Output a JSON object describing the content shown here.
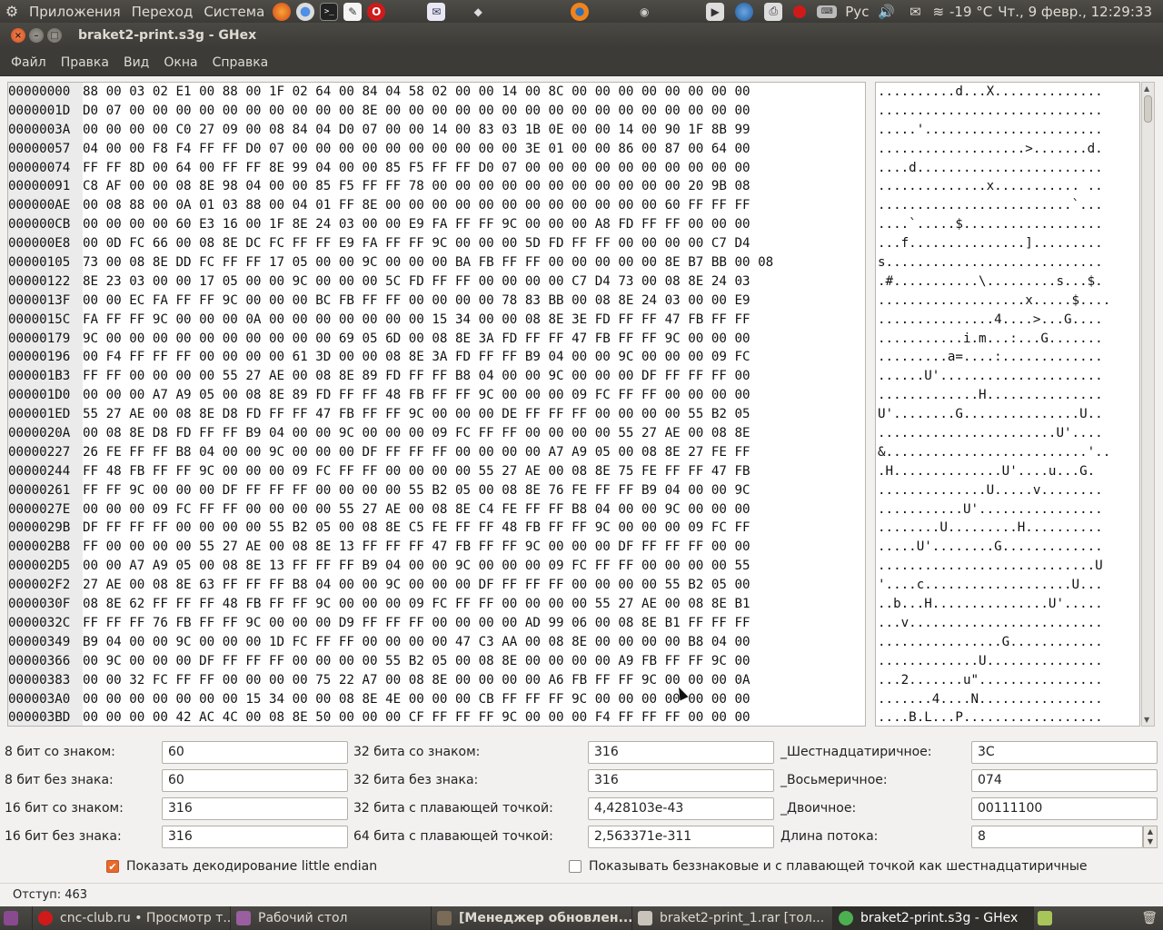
{
  "top_panel": {
    "menus": [
      "Приложения",
      "Переход",
      "Система"
    ],
    "keyboard_layout": "Рус",
    "weather": "-19 °C",
    "clock": "Чт., 9 февр., 12:29:33"
  },
  "window": {
    "title": "braket2-print.s3g - GHex"
  },
  "menu_bar": [
    "Файл",
    "Правка",
    "Вид",
    "Окна",
    "Справка"
  ],
  "hex_rows": [
    {
      "offset": "00000000",
      "hex": "88 00 03 02 E1 00 88 00 1F 02 64 00 84 04 58 02 00 00 14 00 8C 00 00 00 00 00 00 00 00",
      "ascii": "..........d...X.............."
    },
    {
      "offset": "0000001D",
      "hex": "D0 07 00 00 00 00 00 00 00 00 00 00 8E 00 00 00 00 00 00 00 00 00 00 00 00 00 00 00 00",
      "ascii": "............................."
    },
    {
      "offset": "0000003A",
      "hex": "00 00 00 00 C0 27 09 00 08 84 04 D0 07 00 00 14 00 83 03 1B 0E 00 00 14 00 90 1F 8B 99",
      "ascii": ".....'......................."
    },
    {
      "offset": "00000057",
      "hex": "04 00 00 F8 F4 FF FF D0 07 00 00 00 00 00 00 00 00 00 00 3E 01 00 00 86 00 87 00 64 00",
      "ascii": "...................>.......d."
    },
    {
      "offset": "00000074",
      "hex": "FF FF 8D 00 64 00 FF FF 8E 99 04 00 00 85 F5 FF FF D0 07 00 00 00 00 00 00 00 00 00 00",
      "ascii": "....d........................"
    },
    {
      "offset": "00000091",
      "hex": "C8 AF 00 00 08 8E 98 04 00 00 85 F5 FF FF 78 00 00 00 00 00 00 00 00 00 00 00 20 9B 08",
      "ascii": "..............x........... .."
    },
    {
      "offset": "000000AE",
      "hex": "00 08 88 00 0A 01 03 88 00 04 01 FF 8E 00 00 00 00 00 00 00 00 00 00 00 00 60 FF FF FF",
      "ascii": ".........................`..."
    },
    {
      "offset": "000000CB",
      "hex": "00 00 00 00 60 E3 16 00 1F 8E 24 03 00 00 E9 FA FF FF 9C 00 00 00 A8 FD FF FF 00 00 00",
      "ascii": "....`.....$.................."
    },
    {
      "offset": "000000E8",
      "hex": "00 0D FC 66 00 08 8E DC FC FF FF E9 FA FF FF 9C 00 00 00 5D FD FF FF 00 00 00 00 C7 D4",
      "ascii": "...f...............]........."
    },
    {
      "offset": "00000105",
      "hex": "73 00 08 8E DD FC FF FF 17 05 00 00 9C 00 00 00 BA FB FF FF 00 00 00 00 00 8E B7 BB 00 08",
      "ascii": "s............................"
    },
    {
      "offset": "00000122",
      "hex": "8E 23 03 00 00 17 05 00 00 9C 00 00 00 5C FD FF FF 00 00 00 00 C7 D4 73 00 08 8E 24 03",
      "ascii": ".#...........\\.........s...$."
    },
    {
      "offset": "0000013F",
      "hex": "00 00 EC FA FF FF 9C 00 00 00 BC FB FF FF 00 00 00 00 78 83 BB 00 08 8E 24 03 00 00 E9",
      "ascii": "...................x.....$...."
    },
    {
      "offset": "0000015C",
      "hex": "FA FF FF 9C 00 00 00 0A 00 00 00 00 00 00 00 15 34 00 00 08 8E 3E FD FF FF 47 FB FF FF",
      "ascii": "...............4....>...G...."
    },
    {
      "offset": "00000179",
      "hex": "9C 00 00 00 00 00 00 00 00 00 00 69 05 6D 00 08 8E 3A FD FF FF 47 FB FF FF 9C 00 00 00",
      "ascii": "...........i.m...:...G......."
    },
    {
      "offset": "00000196",
      "hex": "00 F4 FF FF FF 00 00 00 00 61 3D 00 00 08 8E 3A FD FF FF B9 04 00 00 9C 00 00 00 09 FC",
      "ascii": ".........a=....:............."
    },
    {
      "offset": "000001B3",
      "hex": "FF FF 00 00 00 00 55 27 AE 00 08 8E 89 FD FF FF B8 04 00 00 9C 00 00 00 DF FF FF FF 00",
      "ascii": "......U'....................."
    },
    {
      "offset": "000001D0",
      "hex": "00 00 00 A7 A9 05 00 08 8E 89 FD FF FF 48 FB FF FF 9C 00 00 00 09 FC FF FF 00 00 00 00",
      "ascii": ".............H..............."
    },
    {
      "offset": "000001ED",
      "hex": "55 27 AE 00 08 8E D8 FD FF FF 47 FB FF FF 9C 00 00 00 DE FF FF FF 00 00 00 00 55 B2 05",
      "ascii": "U'........G...............U.."
    },
    {
      "offset": "0000020A",
      "hex": "00 08 8E D8 FD FF FF B9 04 00 00 9C 00 00 00 09 FC FF FF 00 00 00 00 55 27 AE 00 08 8E",
      "ascii": ".......................U'...."
    },
    {
      "offset": "00000227",
      "hex": "26 FE FF FF B8 04 00 00 9C 00 00 00 DF FF FF FF 00 00 00 00 A7 A9 05 00 08 8E 27 FE FF",
      "ascii": "&..........................'.."
    },
    {
      "offset": "00000244",
      "hex": "FF 48 FB FF FF 9C 00 00 00 09 FC FF FF 00 00 00 00 55 27 AE 00 08 8E 75 FE FF FF 47 FB",
      "ascii": ".H..............U'....u...G."
    },
    {
      "offset": "00000261",
      "hex": "FF FF 9C 00 00 00 DF FF FF FF 00 00 00 00 55 B2 05 00 08 8E 76 FE FF FF B9 04 00 00 9C",
      "ascii": "..............U.....v........"
    },
    {
      "offset": "0000027E",
      "hex": "00 00 00 09 FC FF FF 00 00 00 00 55 27 AE 00 08 8E C4 FE FF FF B8 04 00 00 9C 00 00 00",
      "ascii": "...........U'................"
    },
    {
      "offset": "0000029B",
      "hex": "DF FF FF FF 00 00 00 00 55 B2 05 00 08 8E C5 FE FF FF 48 FB FF FF 9C 00 00 00 09 FC FF",
      "ascii": "........U.........H.........."
    },
    {
      "offset": "000002B8",
      "hex": "FF 00 00 00 00 55 27 AE 00 08 8E 13 FF FF FF 47 FB FF FF 9C 00 00 00 DF FF FF FF 00 00",
      "ascii": ".....U'........G............."
    },
    {
      "offset": "000002D5",
      "hex": "00 00 A7 A9 05 00 08 8E 13 FF FF FF B9 04 00 00 9C 00 00 00 09 FC FF FF 00 00 00 00 55",
      "ascii": "............................U"
    },
    {
      "offset": "000002F2",
      "hex": "27 AE 00 08 8E 63 FF FF FF B8 04 00 00 9C 00 00 00 DF FF FF FF 00 00 00 00 55 B2 05 00",
      "ascii": "'....c...................U..."
    },
    {
      "offset": "0000030F",
      "hex": "08 8E 62 FF FF FF 48 FB FF FF 9C 00 00 00 09 FC FF FF 00 00 00 00 55 27 AE 00 08 8E B1",
      "ascii": "..b...H...............U'....."
    },
    {
      "offset": "0000032C",
      "hex": "FF FF FF 76 FB FF FF 9C 00 00 00 D9 FF FF FF 00 00 00 00 AD 99 06 00 08 8E B1 FF FF FF",
      "ascii": "...v........................."
    },
    {
      "offset": "00000349",
      "hex": "B9 04 00 00 9C 00 00 00 1D FC FF FF 00 00 00 00 47 C3 AA 00 08 8E 00 00 00 00 B8 04 00",
      "ascii": "................G............"
    },
    {
      "offset": "00000366",
      "hex": "00 9C 00 00 00 DF FF FF FF 00 00 00 00 55 B2 05 00 08 8E 00 00 00 00 A9 FB FF FF 9C 00",
      "ascii": ".............U..............."
    },
    {
      "offset": "00000383",
      "hex": "00 00 32 FC FF FF 00 00 00 00 75 22 A7 00 08 8E 00 00 00 00 A6 FB FF FF 9C 00 00 00 0A",
      "ascii": "...2.......u\"................"
    },
    {
      "offset": "000003A0",
      "hex": "00 00 00 00 00 00 00 15 34 00 00 08 8E 4E 00 00 00 CB FF FF FF 9C 00 00 00 00 00 00 00",
      "ascii": ".......4....N................"
    },
    {
      "offset": "000003BD",
      "hex": "00 00 00 00 42 AC 4C 00 08 8E 50 00 00 00 CF FF FF FF 9C 00 00 00 F4 FF FF FF 00 00 00",
      "ascii": "....B.L...P.................."
    }
  ],
  "converter": {
    "labels": {
      "s8": "8 бит со знаком:",
      "u8": "8 бит без знака:",
      "s16": "16 бит со знаком:",
      "u16": "16 бит без знака:",
      "s32": "32 бита со знаком:",
      "u32": "32 бита без знака:",
      "f32": "32 бита с плавающей точкой:",
      "f64": "64 бита с плавающей точкой:",
      "hex": "_Шестнадцатиричное:",
      "oct": "_Восьмеричное:",
      "bin": "_Двоичное:",
      "stream": "Длина потока:"
    },
    "values": {
      "s8": "60",
      "u8": "60",
      "s16": "316",
      "u16": "316",
      "s32": "316",
      "u32": "316",
      "f32": "4,428103e-43",
      "f64": "2,563371e-311",
      "hex": "3C",
      "oct": "074",
      "bin": "00111100",
      "stream": "8"
    },
    "checkbox_little_endian": {
      "label": "Показать декодирование little endian",
      "checked": true
    },
    "checkbox_unsigned_hex": {
      "label": "Показывать беззнаковые и с плавающей точкой как шестнадцатиричные",
      "checked": false
    }
  },
  "status_bar": {
    "text": "Отступ: 463"
  },
  "taskbar": [
    {
      "label": "cnc-club.ru • Просмотр т...",
      "icon": "opera-icon",
      "active": false
    },
    {
      "label": "Рабочий стол",
      "icon": "desktop-icon",
      "active": false
    },
    {
      "label": "[Менеджер обновлен...",
      "icon": "update-manager-icon",
      "active": false
    },
    {
      "label": "braket2-print_1.rar [тол...",
      "icon": "archive-icon",
      "active": false
    },
    {
      "label": "braket2-print.s3g - GHex",
      "icon": "ghex-icon",
      "active": true
    }
  ],
  "colors": {
    "panel": "#3c3b37",
    "accent": "#e9692c",
    "offset_bg": "#ebebeb"
  }
}
